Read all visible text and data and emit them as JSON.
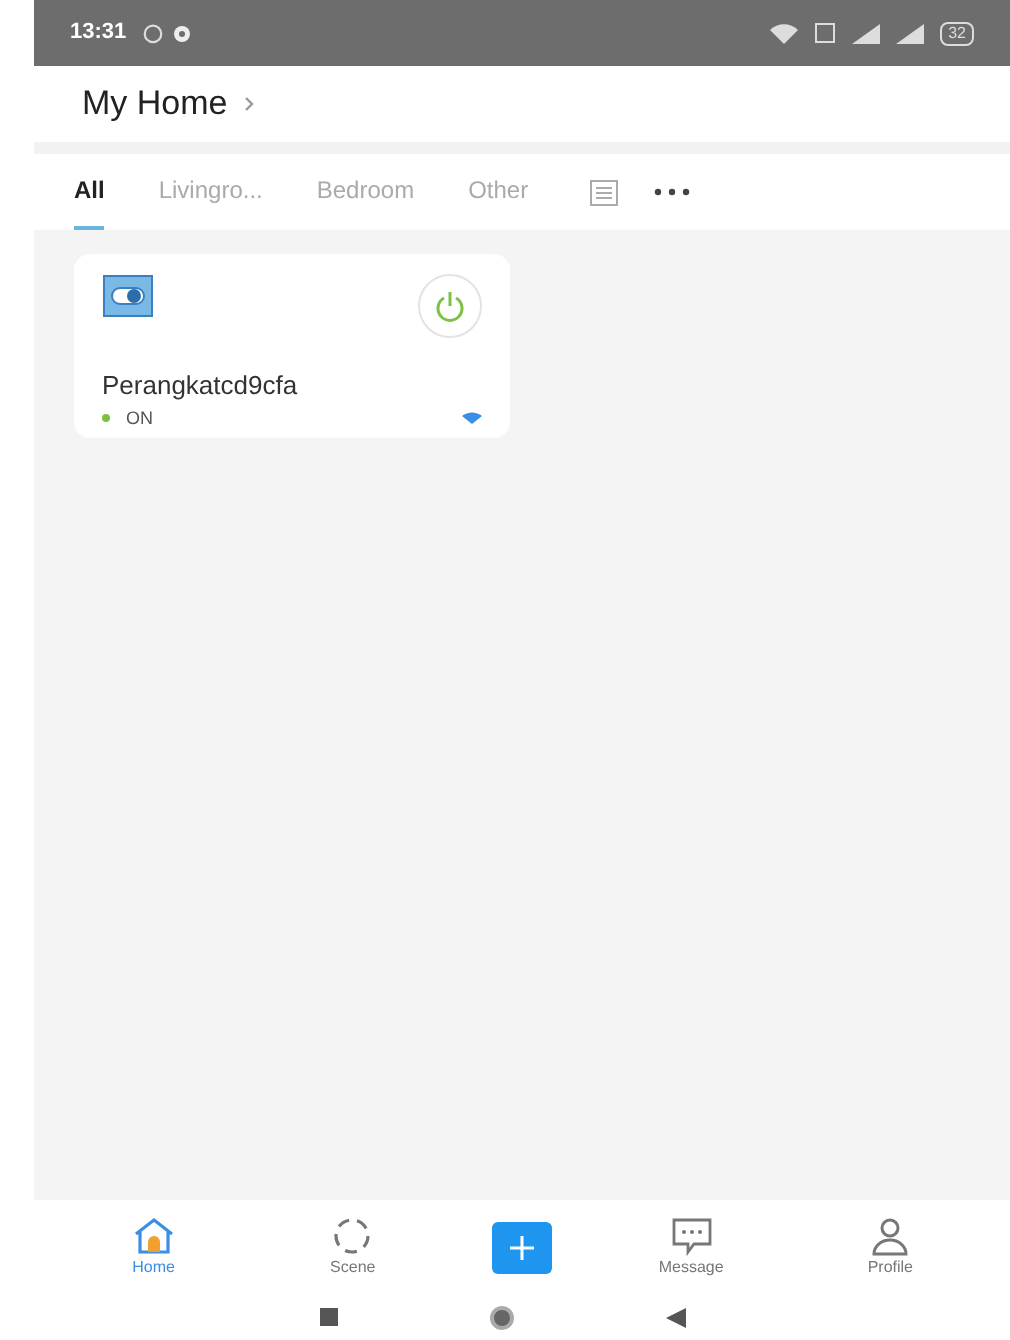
{
  "status_bar": {
    "time": "13:31",
    "battery": "32"
  },
  "header": {
    "title": "My Home"
  },
  "tabs": [
    {
      "label": "All",
      "selected": true
    },
    {
      "label": "Livingro...",
      "selected": false
    },
    {
      "label": "Bedroom",
      "selected": false
    },
    {
      "label": "Other",
      "selected": false
    }
  ],
  "devices": [
    {
      "name": "Perangkatcd9cfa",
      "status": "ON",
      "on": true
    }
  ],
  "nav": [
    {
      "kind": "tab",
      "label": "Home",
      "selected": true
    },
    {
      "kind": "tab",
      "label": "Scene",
      "selected": false
    },
    {
      "kind": "add"
    },
    {
      "kind": "tab",
      "label": "Message",
      "selected": false
    },
    {
      "kind": "tab",
      "label": "Profile",
      "selected": false
    }
  ]
}
